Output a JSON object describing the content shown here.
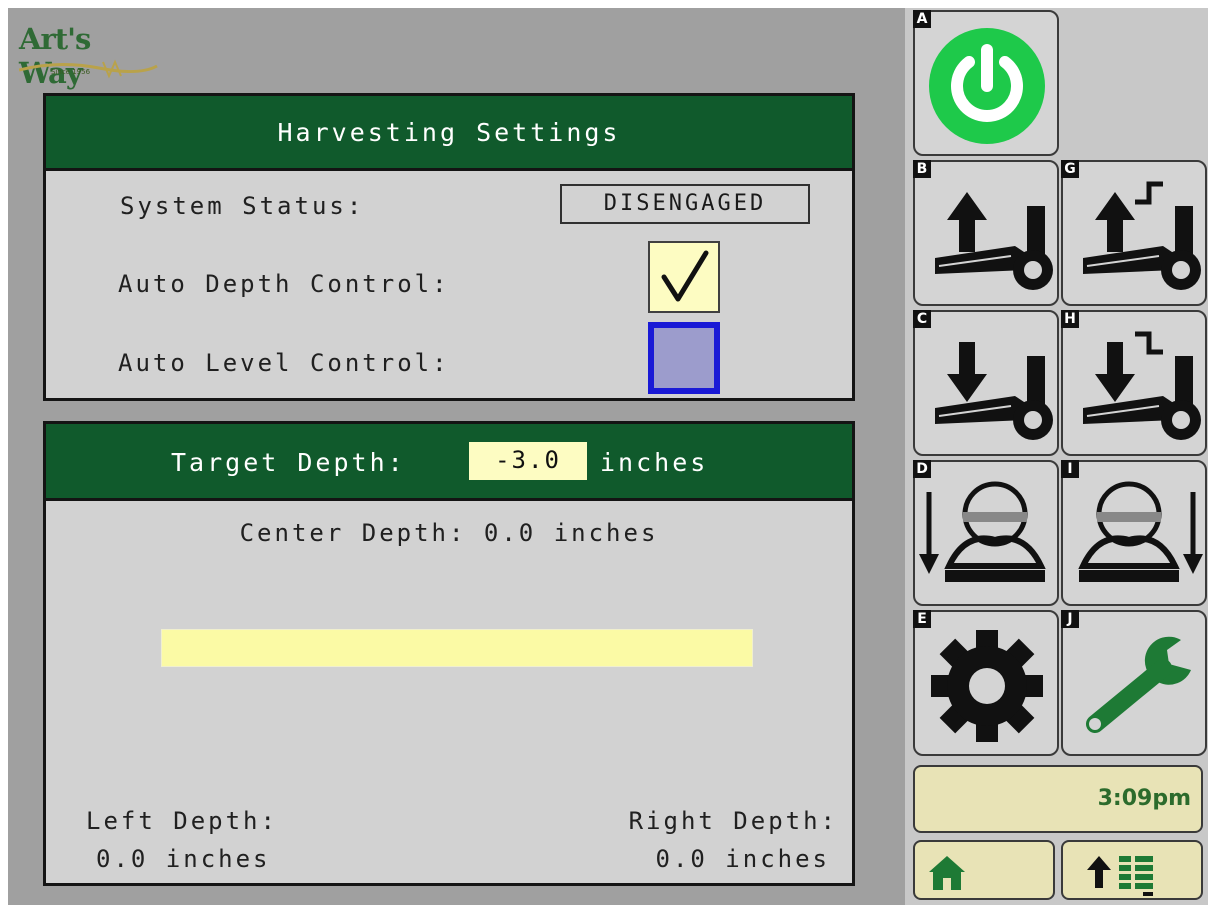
{
  "logo": {
    "brand": "Art's Way",
    "tagline": "Since 1956"
  },
  "settings": {
    "title": "Harvesting Settings",
    "system_status_label": "System Status:",
    "system_status_value": "DISENGAGED",
    "auto_depth_label": "Auto Depth Control:",
    "auto_depth_checked": true,
    "auto_level_label": "Auto Level Control:",
    "auto_level_checked": false
  },
  "depth": {
    "target_label": "Target Depth:",
    "target_value": "-3.0",
    "target_unit": "inches",
    "center_text": "Center Depth: 0.0  inches",
    "left_label": "Left Depth:",
    "left_value": "0.0  inches",
    "right_label": "Right Depth:",
    "right_value": "0.0  inches"
  },
  "softkeys": [
    {
      "letter": "A",
      "icon": "power-icon"
    },
    {
      "letter": "B",
      "icon": "raise-header-icon"
    },
    {
      "letter": "G",
      "icon": "raise-header-step-icon"
    },
    {
      "letter": "C",
      "icon": "lower-header-icon"
    },
    {
      "letter": "H",
      "icon": "lower-header-step-icon"
    },
    {
      "letter": "D",
      "icon": "tilt-left-icon"
    },
    {
      "letter": "I",
      "icon": "tilt-right-icon"
    },
    {
      "letter": "E",
      "icon": "gear-icon"
    },
    {
      "letter": "J",
      "icon": "wrench-icon"
    }
  ],
  "clock": "3:09pm",
  "nav": {
    "home_icon": "home-icon",
    "menu_icon": "menu-up-icon"
  },
  "colors": {
    "header_green": "#105a2c",
    "power_green": "#1ec94a",
    "highlight_yellow": "#fdfcc2",
    "unchecked_blue": "#1a1ad6"
  }
}
